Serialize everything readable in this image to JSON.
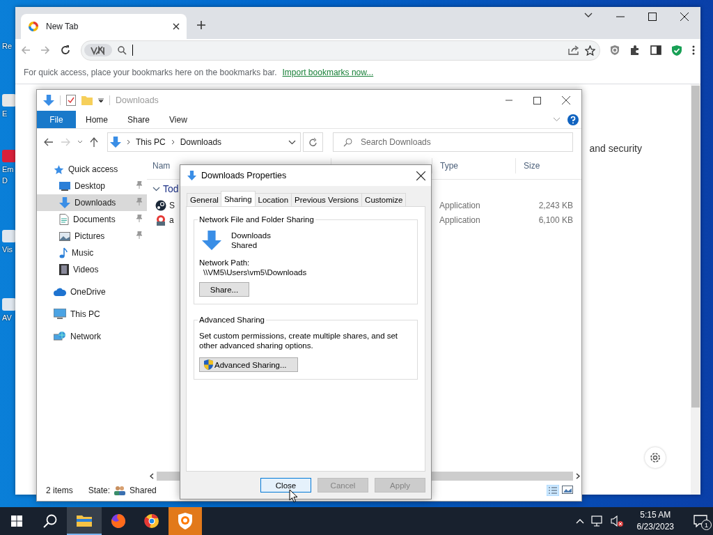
{
  "desktop_icons": [
    {
      "lines": [
        "Re"
      ]
    },
    {
      "lines": [
        "E"
      ]
    },
    {
      "lines": [
        "Em",
        "D"
      ]
    },
    {
      "lines": [
        "Vis"
      ]
    },
    {
      "lines": [
        "AV"
      ]
    }
  ],
  "browser": {
    "tabs": [
      {
        "title": "New Tab",
        "selected": true
      }
    ],
    "bookmarks_hint": "For quick access, place your bookmarks here on the bookmarks bar.",
    "import_link": "Import bookmarks now...",
    "page_text": "and security"
  },
  "explorer": {
    "title": "Downloads",
    "ribbon_tabs": [
      {
        "label": "File",
        "kind": "file"
      },
      {
        "label": "Home",
        "kind": "tab"
      },
      {
        "label": "Share",
        "kind": "tab"
      },
      {
        "label": "View",
        "kind": "tab"
      }
    ],
    "breadcrumb": [
      "This PC",
      "Downloads"
    ],
    "search": {
      "placeholder": "Search Downloads"
    },
    "nav": [
      {
        "label": "Quick access",
        "kind": "star",
        "selected": false,
        "children": [
          {
            "label": "Desktop",
            "kind": "desktop",
            "selected": false,
            "pinned": true
          },
          {
            "label": "Downloads",
            "kind": "downloads",
            "selected": true,
            "pinned": true
          },
          {
            "label": "Documents",
            "kind": "documents",
            "selected": false,
            "pinned": true
          },
          {
            "label": "Pictures",
            "kind": "pictures",
            "selected": false,
            "pinned": true
          },
          {
            "label": "Music",
            "kind": "music",
            "selected": false,
            "pinned": false
          },
          {
            "label": "Videos",
            "kind": "videos",
            "selected": false,
            "pinned": false
          }
        ]
      },
      {
        "label": "OneDrive",
        "kind": "cloud",
        "selected": false
      },
      {
        "label": "This PC",
        "kind": "pc",
        "selected": false
      },
      {
        "label": "Network",
        "kind": "network",
        "selected": false
      }
    ],
    "columns": [
      {
        "label": "Nam",
        "kind": "name"
      },
      {
        "label": "Type",
        "kind": "type"
      },
      {
        "label": "Size",
        "kind": "size"
      }
    ],
    "group": "Tod",
    "files": [
      {
        "name": "S",
        "kind": "steam",
        "type": "Application",
        "size": "2,243 KB"
      },
      {
        "name": "a",
        "kind": "setup",
        "type": "Application",
        "size": "6,100 KB"
      }
    ],
    "status": {
      "count": "2 items",
      "state_label": "State:",
      "state": "Shared"
    }
  },
  "dialog": {
    "title": "Downloads Properties",
    "tabs": [
      {
        "label": "General",
        "selected": false
      },
      {
        "label": "Sharing",
        "selected": true
      },
      {
        "label": "Location",
        "selected": false
      },
      {
        "label": "Previous Versions",
        "selected": false
      },
      {
        "label": "Customize",
        "selected": false
      }
    ],
    "sharing_group": {
      "title": "Network File and Folder Sharing",
      "folder": "Downloads",
      "state": "Shared",
      "path_label": "Network Path:",
      "path": "\\\\VM5\\Users\\vm5\\Downloads",
      "button": "Share..."
    },
    "advanced_group": {
      "title": "Advanced Sharing",
      "description": "Set custom permissions, create multiple shares, and set other advanced sharing options.",
      "button": "Advanced Sharing..."
    },
    "buttons": [
      {
        "label": "Close",
        "disabled": false
      },
      {
        "label": "Cancel",
        "disabled": true
      },
      {
        "label": "Apply",
        "disabled": true
      }
    ]
  },
  "taskbar": {
    "apps": [
      {
        "kind": "explorer",
        "selected": true,
        "attention": false
      },
      {
        "kind": "firefox",
        "selected": false,
        "attention": false
      },
      {
        "kind": "chrome",
        "selected": false,
        "attention": false
      },
      {
        "kind": "shield-browser",
        "selected": false,
        "attention": true
      }
    ],
    "time": "5:15 AM",
    "date": "6/23/2023",
    "notifications": "1"
  }
}
